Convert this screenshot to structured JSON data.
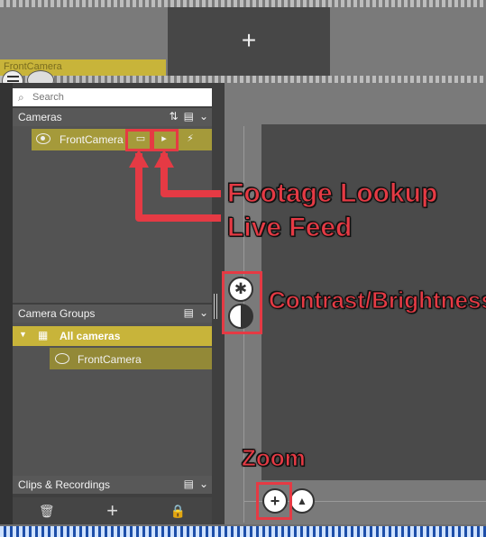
{
  "timeline": {
    "left_label": "FrontCamera",
    "add_symbol": "+"
  },
  "search": {
    "placeholder": "Search"
  },
  "cameras": {
    "title": "Cameras",
    "sort_glyph": "⇅",
    "chevron": "⌄",
    "items": [
      {
        "name": "FrontCamera"
      }
    ]
  },
  "camera_groups": {
    "title": "Camera Groups",
    "chevron": "⌄",
    "group": {
      "name": "All cameras",
      "glyph": "▦",
      "expand_glyph": "▼"
    },
    "members": [
      {
        "name": "FrontCamera"
      }
    ]
  },
  "clips": {
    "title": "Clips & Recordings",
    "chevron": "⌄",
    "trash_glyph": "🗑",
    "add_glyph": "+",
    "lock_glyph": "🔒"
  },
  "viewer": {
    "zoom_glyph": "+"
  },
  "annotations": {
    "footage_lookup": "Footage Lookup",
    "live_feed": "Live Feed",
    "contrast_brightness": "Contrast/Brightness",
    "zoom": "Zoom"
  },
  "colors": {
    "accent_yellow": "#c8b43a",
    "selection": "#a59a3a",
    "annotation_red": "#e53a44",
    "timeline_blue": "#1d4ea8"
  }
}
